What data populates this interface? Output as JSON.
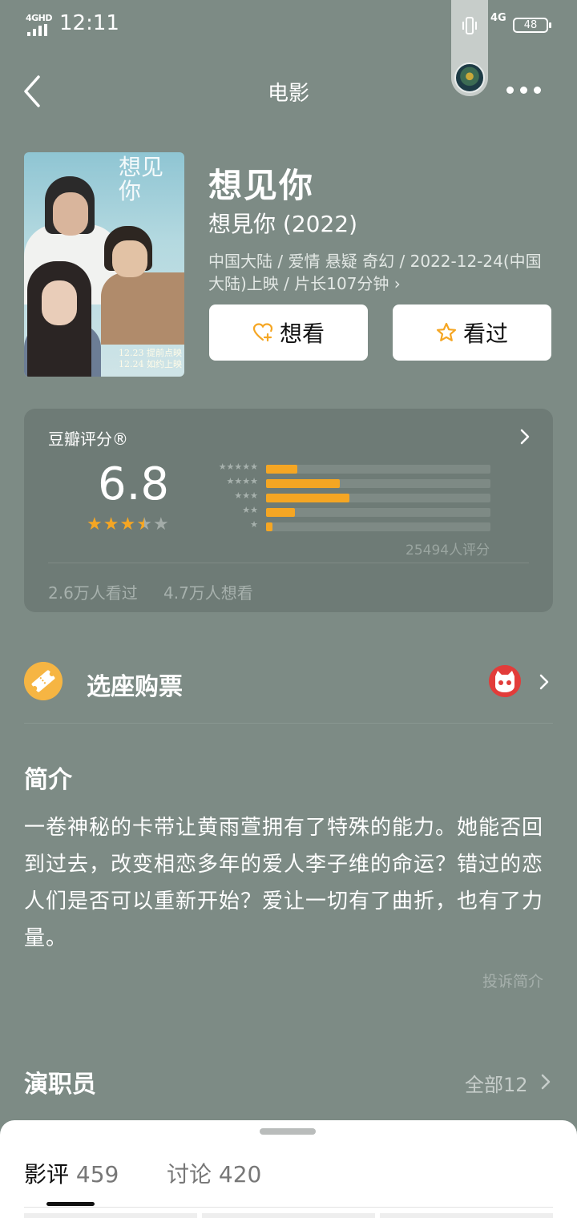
{
  "status_bar": {
    "network_label": "4GHD",
    "time": "12:11",
    "network_right": "4G",
    "battery": "48"
  },
  "nav": {
    "title": "电影"
  },
  "movie": {
    "title": "想见你",
    "original_title": "想見你 (2022)",
    "meta": "中国大陆 / 爱情 悬疑 奇幻 / 2022-12-24(中国大陆)上映 / 片长107分钟 ›",
    "poster": {
      "title_text": "想见\n你",
      "date_text": "12.23 提前点映\n12.24 如约上映"
    }
  },
  "actions": {
    "want_label": "想看",
    "seen_label": "看过"
  },
  "rating": {
    "label": "豆瓣评分®",
    "score": "6.8",
    "stars_value": 3.5,
    "distribution": [
      {
        "stars": "★★★★★",
        "percent": 14
      },
      {
        "stars": "★★★★",
        "percent": 33
      },
      {
        "stars": "★★★",
        "percent": 37
      },
      {
        "stars": "★★",
        "percent": 13
      },
      {
        "stars": "★",
        "percent": 3
      }
    ],
    "count_text": "25494人评分",
    "watched_text": "2.6万人看过",
    "wish_text": "4.7万人想看",
    "accent_color": "#f5a623"
  },
  "ticket": {
    "label": "选座购票"
  },
  "synopsis": {
    "title": "简介",
    "text": "一卷神秘的卡带让黄雨萱拥有了特殊的能力。她能否回到过去，改变相恋多年的爱人李子维的命运？错过的恋人们是否可以重新开始？爱让一切有了曲折，也有了力量。",
    "report_label": "投诉简介"
  },
  "cast": {
    "title": "演职员",
    "all_label": "全部12"
  },
  "sheet": {
    "tabs": [
      {
        "label": "影评",
        "count": "459"
      },
      {
        "label": "讨论",
        "count": "420"
      }
    ]
  }
}
